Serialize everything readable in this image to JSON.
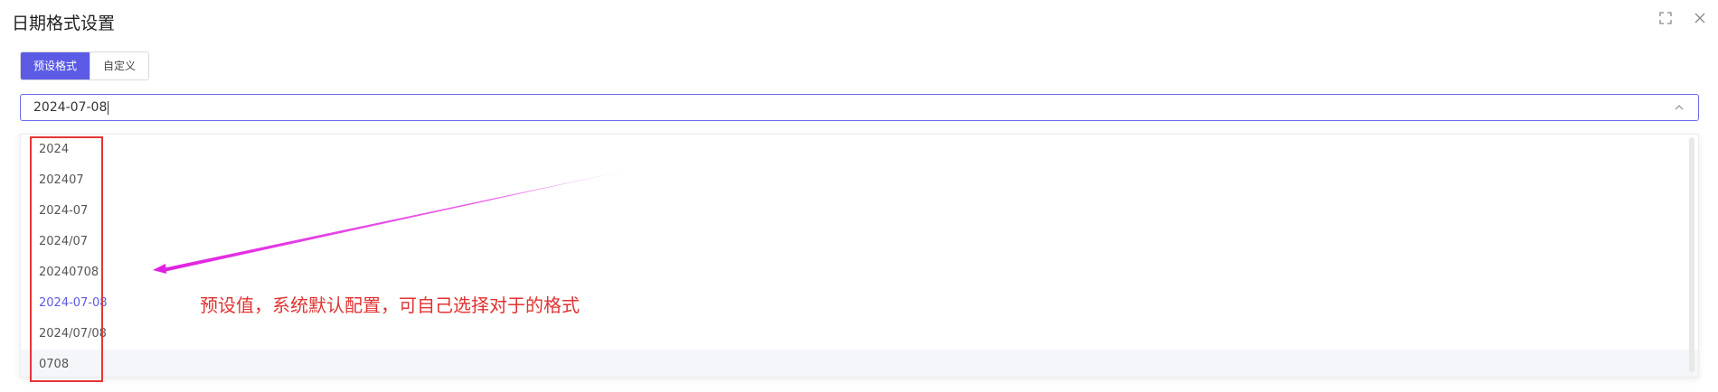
{
  "dialog": {
    "title": "日期格式设置"
  },
  "window_icons": [
    "fullscreen-icon",
    "close-icon"
  ],
  "tabs": [
    {
      "label": "预设格式",
      "active": true
    },
    {
      "label": "自定义",
      "active": false
    }
  ],
  "select": {
    "value": "2024-07-08"
  },
  "options": [
    {
      "label": "2024"
    },
    {
      "label": "202407"
    },
    {
      "label": "2024-07"
    },
    {
      "label": "2024/07"
    },
    {
      "label": "20240708"
    },
    {
      "label": "2024-07-08",
      "selected": true
    },
    {
      "label": "2024/07/08"
    },
    {
      "label": "0708",
      "hovered": true
    }
  ],
  "annotation": {
    "text": "预设值，系统默认配置，可自己选择对于的格式"
  },
  "colors": {
    "accent": "#5b5be6",
    "annotation_red": "#e53535",
    "arrow_magenta": "#e020e0"
  }
}
